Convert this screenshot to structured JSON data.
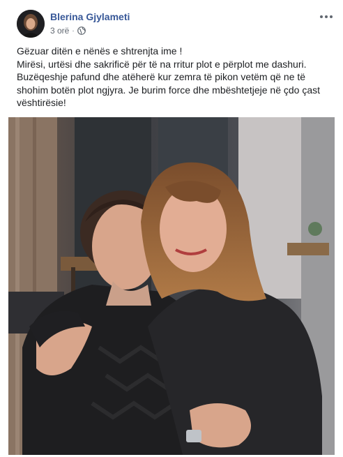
{
  "post": {
    "author": "Blerina Gjylameti",
    "time": "3 orë",
    "separator": "·",
    "audience_icon": "globe-icon",
    "more_icon": "more-options-icon",
    "text_lines": [
      "Gëzuar ditën e nënës e shtrenjta ime !",
      "Mirësi, urtësi dhe sakrificë për të na rritur plot e përplot me dashuri.",
      "Buzëqeshje pafund dhe atëherë kur zemra të pikon vetëm që ne të",
      "shohim botën plot ngjyra. Je burim force dhe mbështetjeje në çdo çast",
      "vështirësie!"
    ]
  },
  "colors": {
    "author_link": "#385898",
    "meta_text": "#606770",
    "body_text": "#1c1e21"
  }
}
